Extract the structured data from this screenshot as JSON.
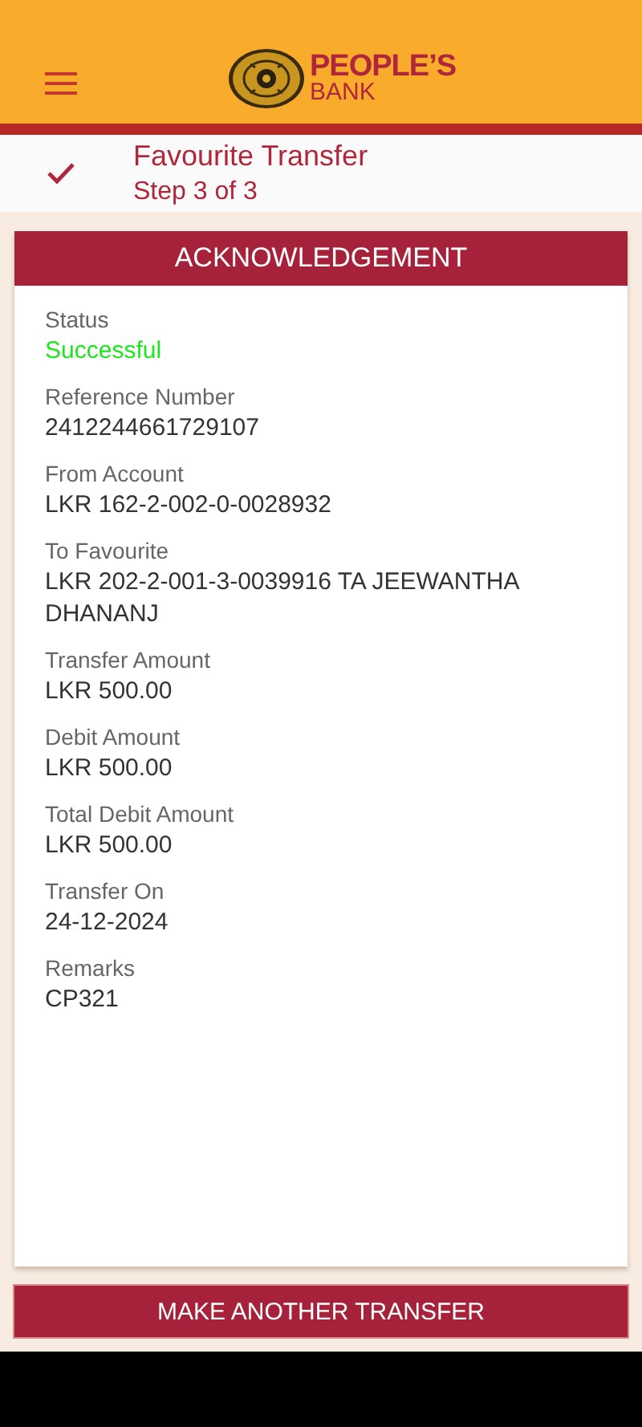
{
  "header": {
    "logo": {
      "line_1": "PEOPLE’S",
      "line_2": "BANK"
    }
  },
  "step": {
    "done": true,
    "title": "Favourite Transfer",
    "subtitle": "Step 3 of 3"
  },
  "card": {
    "title": "ACKNOWLEDGEMENT",
    "fields": [
      {
        "label": "Status",
        "value": "Successful",
        "kind": "status"
      },
      {
        "label": "Reference Number",
        "value": "2412244661729107",
        "kind": "text"
      },
      {
        "label": "From Account",
        "value": "LKR 162-2-002-0-0028932",
        "kind": "text"
      },
      {
        "label": "To Favourite",
        "value": "LKR 202-2-001-3-0039916 TA JEEWANTHA DHANANJ",
        "kind": "text"
      },
      {
        "label": "Transfer Amount",
        "value": "LKR 500.00",
        "kind": "text"
      },
      {
        "label": "Debit Amount",
        "value": "LKR 500.00",
        "kind": "text"
      },
      {
        "label": "Total Debit Amount",
        "value": "LKR 500.00",
        "kind": "text"
      },
      {
        "label": "Transfer On",
        "value": "24-12-2024",
        "kind": "text"
      },
      {
        "label": "Remarks",
        "value": "CP321",
        "kind": "text"
      }
    ]
  },
  "action_button": "MAKE ANOTHER TRANSFER"
}
